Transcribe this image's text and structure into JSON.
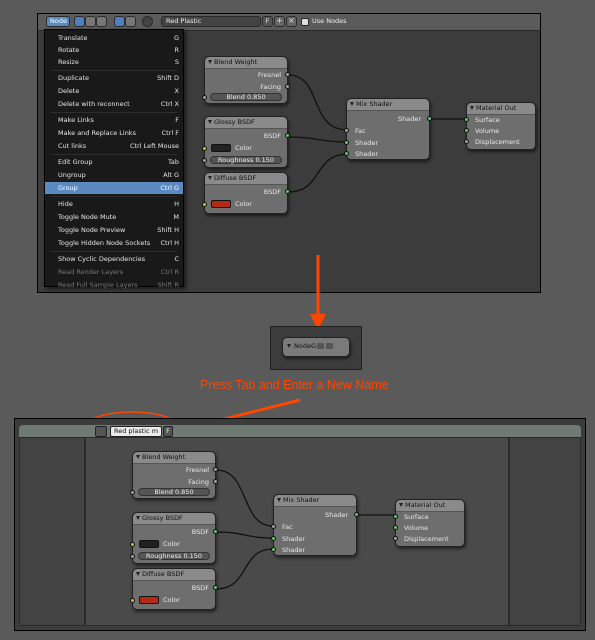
{
  "header": {
    "editor_label": "Node",
    "material_name": "Red Plastic",
    "f_label": "F",
    "use_nodes_label": "Use Nodes"
  },
  "menu": {
    "items": [
      {
        "label": "Translate",
        "key": "G"
      },
      {
        "label": "Rotate",
        "key": "R"
      },
      {
        "label": "Resize",
        "key": "S"
      },
      {
        "label": "Duplicate",
        "key": "Shift D"
      },
      {
        "label": "Delete",
        "key": "X"
      },
      {
        "label": "Delete with reconnect",
        "key": "Ctrl X"
      },
      {
        "label": "Make Links",
        "key": "F"
      },
      {
        "label": "Make and Replace Links",
        "key": "Ctrl F"
      },
      {
        "label": "Cut links",
        "key": "Ctrl Left Mouse"
      },
      {
        "label": "Edit Group",
        "key": "Tab"
      },
      {
        "label": "Ungroup",
        "key": "Alt G"
      },
      {
        "label": "Group",
        "key": "Ctrl G"
      },
      {
        "label": "Hide",
        "key": "H"
      },
      {
        "label": "Toggle Node Mute",
        "key": "M"
      },
      {
        "label": "Toggle Node Preview",
        "key": "Shift H"
      },
      {
        "label": "Toggle Hidden Node Sockets",
        "key": "Ctrl H"
      },
      {
        "label": "Show Cyclic Dependencies",
        "key": "C"
      },
      {
        "label": "Read Render Layers",
        "key": "Ctrl R"
      },
      {
        "label": "Read Full Sample Layers",
        "key": "Shift R"
      }
    ]
  },
  "nodes": {
    "blend_weight": {
      "title": "Blend Weight",
      "fresnel": "Fresnel",
      "facing": "Facing",
      "blend": "Blend 0.850"
    },
    "glossy": {
      "title": "Glossy BSDF",
      "bsdf": "BSDF",
      "color": "Color",
      "roughness": "Roughness 0.150"
    },
    "diffuse": {
      "title": "Diffuse BSDF",
      "bsdf": "BSDF",
      "color": "Color"
    },
    "mix": {
      "title": "Mix Shader",
      "shader_out": "Shader",
      "fac": "Fac",
      "shader1": "Shader",
      "shader2": "Shader"
    },
    "output": {
      "title": "Material Out",
      "surface": "Surface",
      "volume": "Volume",
      "displacement": "Displacement"
    }
  },
  "group_node": {
    "title": "NodeG"
  },
  "annotation": {
    "text": "Press Tab and Enter a New Name"
  },
  "bottom_header": {
    "group_name": "Red plastic",
    "suffix": "m",
    "f_label": "F"
  },
  "colors": {
    "accent": "#5b8ac0",
    "annotation": "#ff4500",
    "swatch_red": "#b52a14",
    "swatch_dark": "#222222",
    "socket_green": "#63c763",
    "socket_gray": "#a1a1a1",
    "socket_yellow": "#c7c729"
  }
}
